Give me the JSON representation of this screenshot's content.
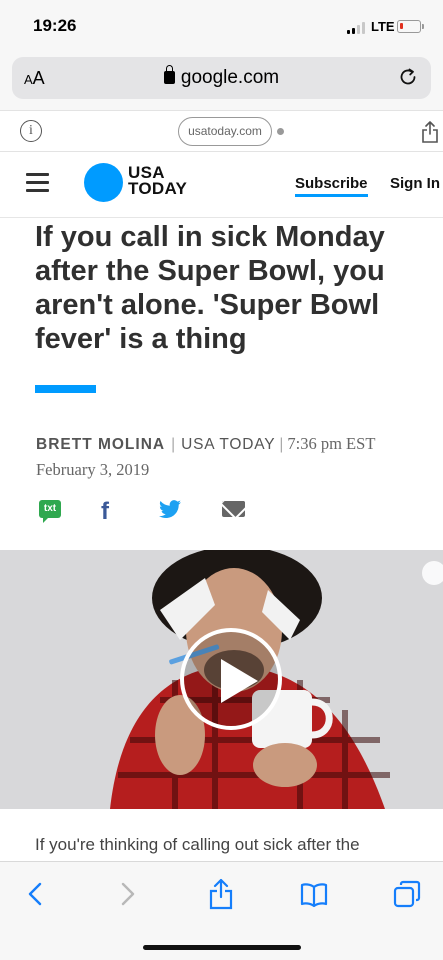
{
  "status_bar": {
    "time": "19:26",
    "network": "LTE",
    "battery_level": 0.15,
    "battery_color": "#e0301e"
  },
  "browser": {
    "text_size_label": "AA",
    "url": "google.com",
    "reload_icon": "reload-icon",
    "site_pill": "usatoday.com"
  },
  "site_header": {
    "logo_line1": "USA",
    "logo_line2": "TODAY",
    "subscribe": "Subscribe",
    "sign_in": "Sign In",
    "brand_color": "#009bff"
  },
  "article": {
    "headline": "If you call in sick Monday after the Super Bowl, you aren't alone. 'Super Bowl fever' is a thing",
    "author": "BRETT MOLINA",
    "publication": "USA TODAY",
    "time": "7:36 pm EST",
    "date": "February 3, 2019",
    "teaser": "If you're thinking of calling out sick after the"
  },
  "share": {
    "txt_label": "txt",
    "facebook_label": "f",
    "icons": [
      "sms-icon",
      "facebook-icon",
      "twitter-icon",
      "email-icon"
    ]
  },
  "video": {
    "play_icon": "play-icon"
  },
  "toolbar": {
    "icons": [
      "back-icon",
      "forward-icon",
      "share-icon",
      "bookmarks-icon",
      "tabs-icon"
    ],
    "active_color": "#157efb",
    "disabled_color": "#b8b8b8"
  }
}
